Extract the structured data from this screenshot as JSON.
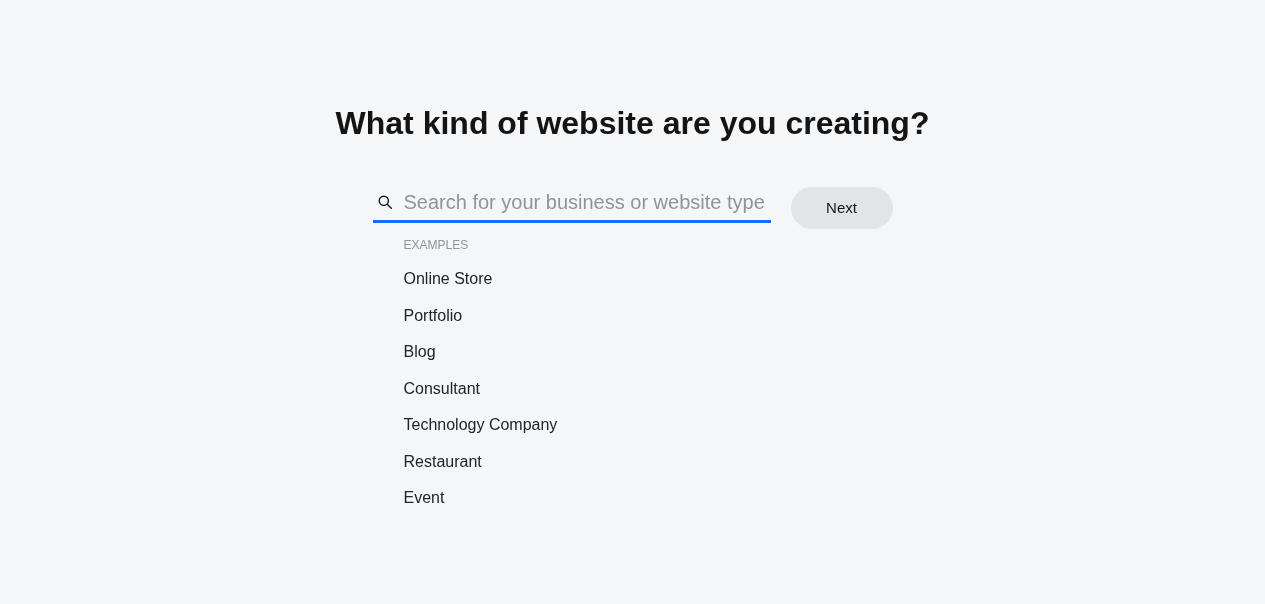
{
  "title": "What kind of website are you creating?",
  "search": {
    "placeholder": "Search for your business or website type"
  },
  "next_button": {
    "label": "Next"
  },
  "examples": {
    "heading": "EXAMPLES",
    "items": [
      "Online Store",
      "Portfolio",
      "Blog",
      "Consultant",
      "Technology Company",
      "Restaurant",
      "Event"
    ]
  }
}
